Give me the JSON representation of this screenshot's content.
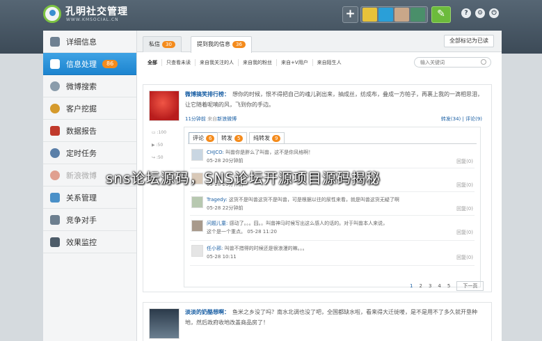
{
  "app": {
    "brand": "孔明社交管理",
    "domain": "WWW.KMSOCIAL.CN",
    "help": "?",
    "settings": "⚙",
    "power": "⏻",
    "add": "+",
    "compose": "✎"
  },
  "sidebar": {
    "items": [
      {
        "label": "详细信息"
      },
      {
        "label": "信息处理",
        "count": "86"
      },
      {
        "label": "微博搜索"
      },
      {
        "label": "客户挖掘"
      },
      {
        "label": "数据报告"
      },
      {
        "label": "定时任务"
      },
      {
        "label": "新浪微博"
      },
      {
        "label": "关系管理"
      },
      {
        "label": "竞争对手"
      },
      {
        "label": "效果监控"
      }
    ]
  },
  "tabs": [
    {
      "label": "私信",
      "count": "30"
    },
    {
      "label": "提到我的信息",
      "count": "36"
    }
  ],
  "mark_all": "全部标记为已读",
  "filters": [
    "全部",
    "只查看未读",
    "来自我关注的人",
    "来自我的粉丝",
    "来自+V用户",
    "来自陌生人"
  ],
  "search": {
    "placeholder": "输入关键词"
  },
  "post1": {
    "author": "微博搞笑排行榜：",
    "text": "想你的时候，恨不得把自己的魂儿剥出来，抽成丝，纺成布，叠成一方帕子，再裹上我的一滴相思泪，让它随着呢喃的风，飞到你的手边。",
    "time": "11分钟前",
    "from": "来自",
    "source": "新浪微博",
    "stats": "转发(34) | 评论(9)",
    "ops": [
      ":100",
      ":50",
      ":50"
    ],
    "comment_tabs": [
      {
        "label": "评论",
        "count": "6"
      },
      {
        "label": "转发",
        "count": "5"
      },
      {
        "label": "纯转发",
        "count": "9"
      }
    ],
    "comments": [
      {
        "name": "CHJCO:",
        "text": "叫兽你是胖么了叫兽，这不是你风格啊！",
        "line2": "05-28 20分钟前",
        "reply": "回复(0)"
      },
      {
        "name": "",
        "text": "",
        "line2": "05-28 20分钟前",
        "reply": "回复(0)"
      },
      {
        "name": "Tragedy:",
        "text": "这货不是叫兽这货不是叫兽，可是根据以往的尿性来看，就是叫兽这货无疑了啊",
        "line2": "05-28  22分钟前",
        "reply": "回复(0)"
      },
      {
        "name": "问题儿童:",
        "text": "感动了。。。囧。。叫兽神马时候写出这么感人的话的。对于叫兽本人来说，",
        "line2": "这个是一个重点。 05-28 11:20",
        "reply": "回复(0)"
      },
      {
        "name": "任小邪:",
        "text": "叫兽不措得的时候还是很浪漫的嘛。。。",
        "line2": "05-28 10:11",
        "reply": "回复(0)"
      }
    ],
    "pages": [
      "1",
      "2",
      "3",
      "4",
      "5"
    ],
    "next": "下一页"
  },
  "post2": {
    "author": "淡淡的奶酪想啊：",
    "text": "鱼米之乡没了吗？南水北调也没了吧，全国都缺水啦，看来得大迁徙喽，是不是用不了多久就开垦种地，然后政府收地改盖商品房了！"
  },
  "overlay": "sns论坛源码，SNS论坛开源项目源码揭秘",
  "colors": {
    "topbar": "#3c4a57",
    "active_nav": "#2a93da",
    "badge": "#f48b1c",
    "link": "#1a5fa4",
    "compose": "#6cbb3c"
  }
}
